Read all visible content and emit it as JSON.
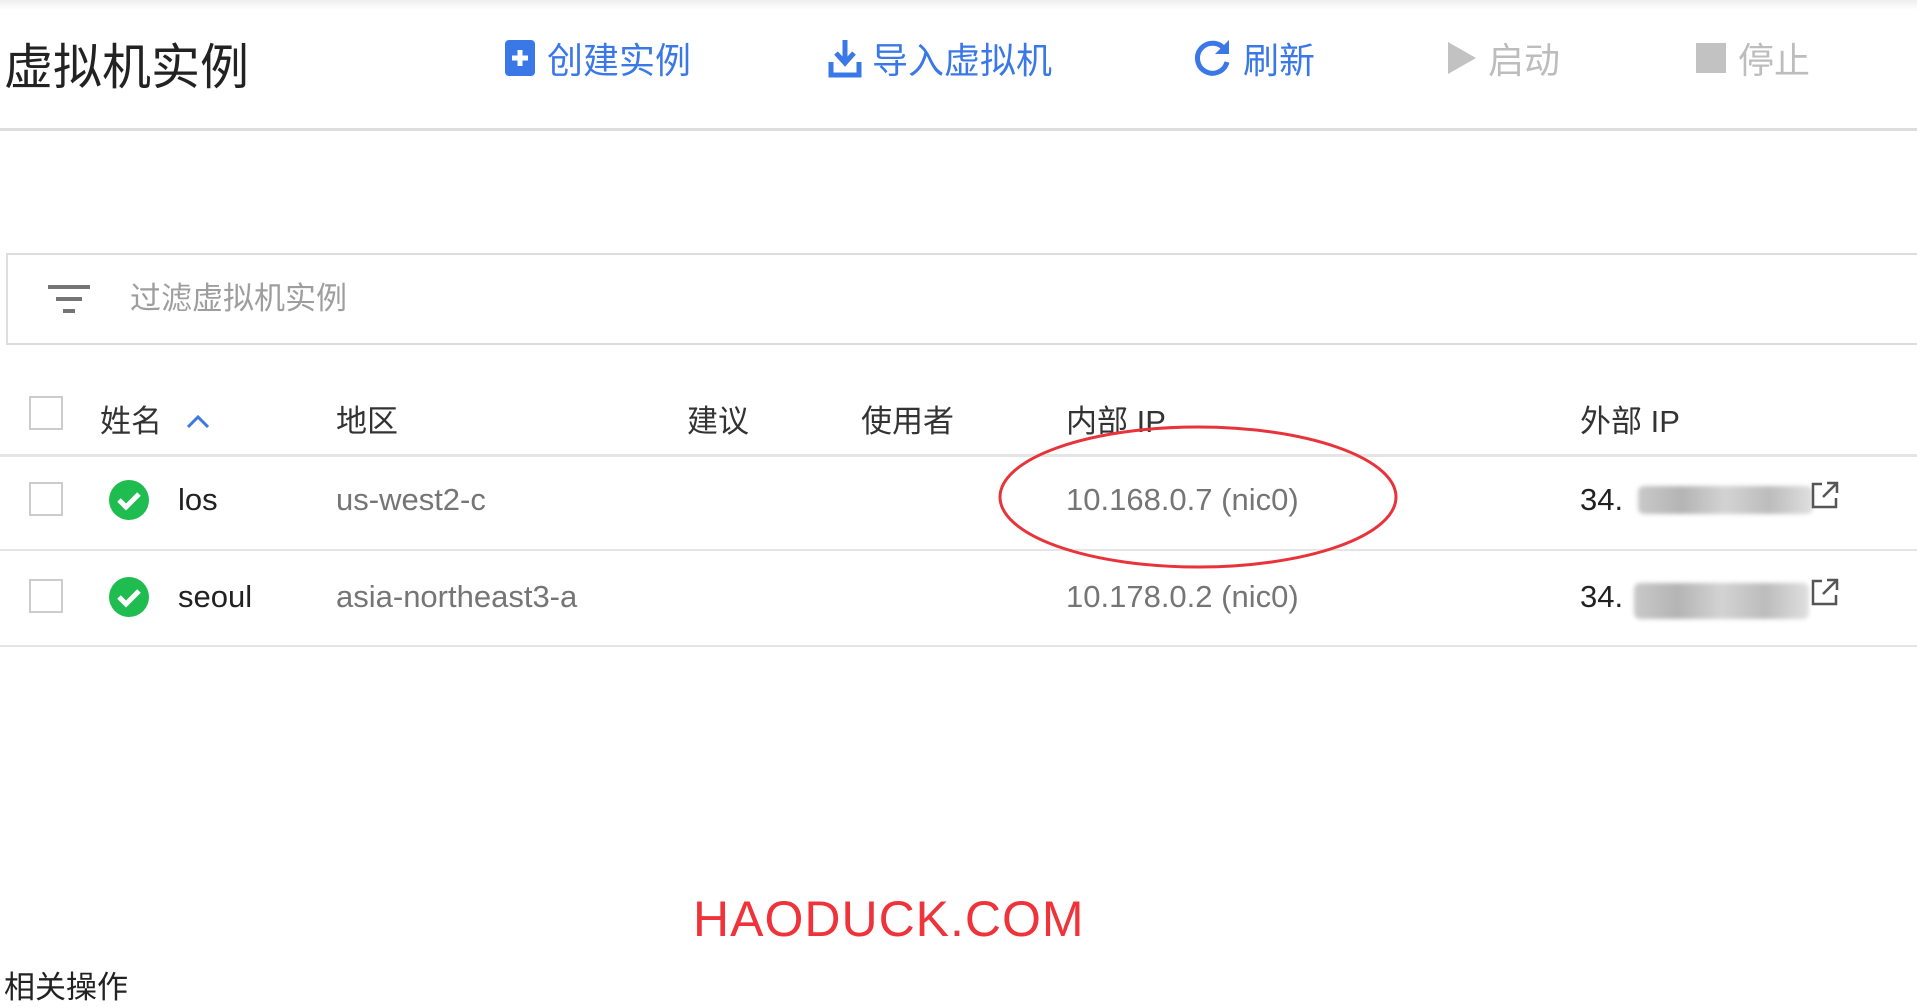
{
  "header": {
    "title": "虚拟机实例",
    "actions": [
      {
        "label": "创建实例",
        "icon": "add-box-icon",
        "enabled": true
      },
      {
        "label": "导入虚拟机",
        "icon": "download-icon",
        "enabled": true
      },
      {
        "label": "刷新",
        "icon": "refresh-icon",
        "enabled": true
      },
      {
        "label": "启动",
        "icon": "play-icon",
        "enabled": false
      },
      {
        "label": "停止",
        "icon": "stop-icon",
        "enabled": false
      }
    ]
  },
  "filter": {
    "placeholder": "过滤虚拟机实例",
    "icon": "filter-icon"
  },
  "table": {
    "columns": [
      "姓名",
      "地区",
      "建议",
      "使用者",
      "内部 IP",
      "外部 IP"
    ],
    "rows": [
      {
        "name": "los",
        "zone": "us-west2-c",
        "suggestion": "",
        "user": "",
        "internal_ip": "10.168.0.7 (nic0)",
        "external_ip": "34.",
        "status": "running"
      },
      {
        "name": "seoul",
        "zone": "asia-northeast3-a",
        "suggestion": "",
        "user": "",
        "internal_ip": "10.178.0.2 (nic0)",
        "external_ip": "34.",
        "status": "running"
      }
    ]
  },
  "watermark": "HAODUCK.COM",
  "related": "相关操作",
  "colors": {
    "accent": "#3b78e7",
    "ok": "#1fbd4f",
    "annotation": "#e8333a"
  }
}
